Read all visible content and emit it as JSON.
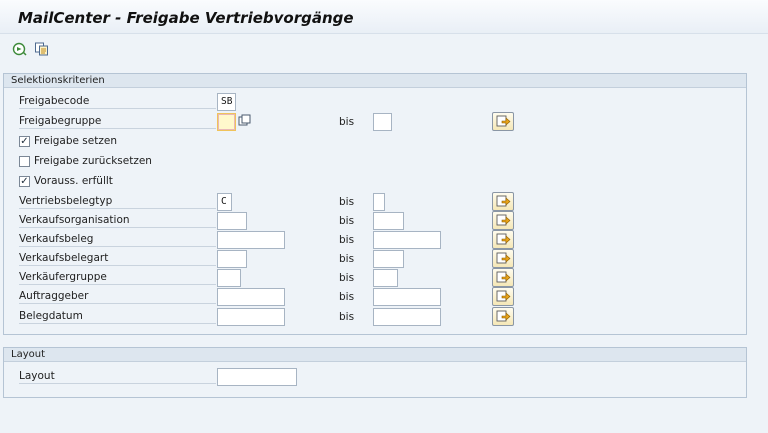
{
  "window": {
    "title": "MailCenter - Freigabe Vertriebvorgänge"
  },
  "toolbar": {
    "buttons": [
      "execute-icon",
      "variant-icon"
    ]
  },
  "selection": {
    "header": "Selektionskriterien",
    "bis_label": "bis",
    "freigabecode": {
      "label": "Freigabecode",
      "value": "SB"
    },
    "freigabegruppe": {
      "label": "Freigabegruppe",
      "value": ""
    },
    "checkboxes": [
      {
        "label": "Freigabe setzen",
        "checked": true,
        "mark": "✓"
      },
      {
        "label": "Freigabe zurücksetzen",
        "checked": false,
        "mark": ""
      },
      {
        "label": "Vorauss. erfüllt",
        "checked": true,
        "mark": "✓"
      }
    ],
    "ranges": [
      {
        "label": "Vertriebsbelegtyp",
        "low": "C",
        "high": ""
      },
      {
        "label": "Verkaufsorganisation",
        "low": "",
        "high": ""
      },
      {
        "label": "Verkaufsbeleg",
        "low": "",
        "high": ""
      },
      {
        "label": "Verkaufsbelegart",
        "low": "",
        "high": ""
      },
      {
        "label": "Verkäufergruppe",
        "low": "",
        "high": ""
      },
      {
        "label": "Auftraggeber",
        "low": "",
        "high": ""
      },
      {
        "label": "Belegdatum",
        "low": "",
        "high": ""
      }
    ]
  },
  "layout": {
    "header": "Layout",
    "label": "Layout",
    "value": ""
  },
  "colors": {
    "background": "#eef3f8",
    "group_header": "#dde6ef",
    "required_field": "#fff8cc"
  }
}
